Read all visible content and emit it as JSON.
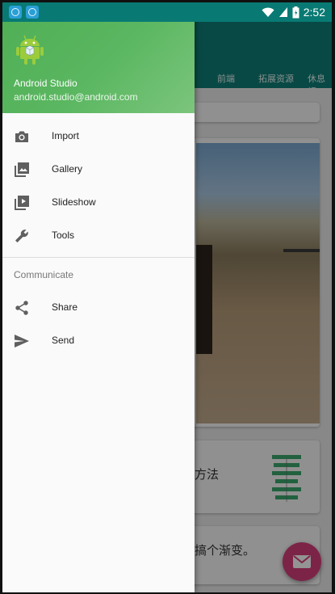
{
  "status_bar": {
    "time": "2:52",
    "left_icons": [
      "sync-icon",
      "sync-icon"
    ],
    "right_icons": [
      "wifi-icon",
      "signal-icon",
      "battery-icon"
    ]
  },
  "background_app": {
    "tabs": [
      "前端",
      "拓展资源",
      "休息视"
    ],
    "cards": [
      {
        "text": "方法"
      },
      {
        "text": "搞个渐变。"
      }
    ],
    "fab_icon": "mail-icon",
    "fab_color": "#d63f7a",
    "toolbar_color": "#0e7f78"
  },
  "drawer": {
    "header": {
      "name": "Android Studio",
      "email": "android.studio@android.com",
      "logo": "android-robot-icon",
      "color": "#5bb761"
    },
    "items": [
      {
        "label": "Import",
        "icon": "camera-icon"
      },
      {
        "label": "Gallery",
        "icon": "gallery-icon"
      },
      {
        "label": "Slideshow",
        "icon": "slideshow-icon"
      },
      {
        "label": "Tools",
        "icon": "wrench-icon"
      }
    ],
    "section_title": "Communicate",
    "section_items": [
      {
        "label": "Share",
        "icon": "share-icon"
      },
      {
        "label": "Send",
        "icon": "send-icon"
      }
    ]
  }
}
